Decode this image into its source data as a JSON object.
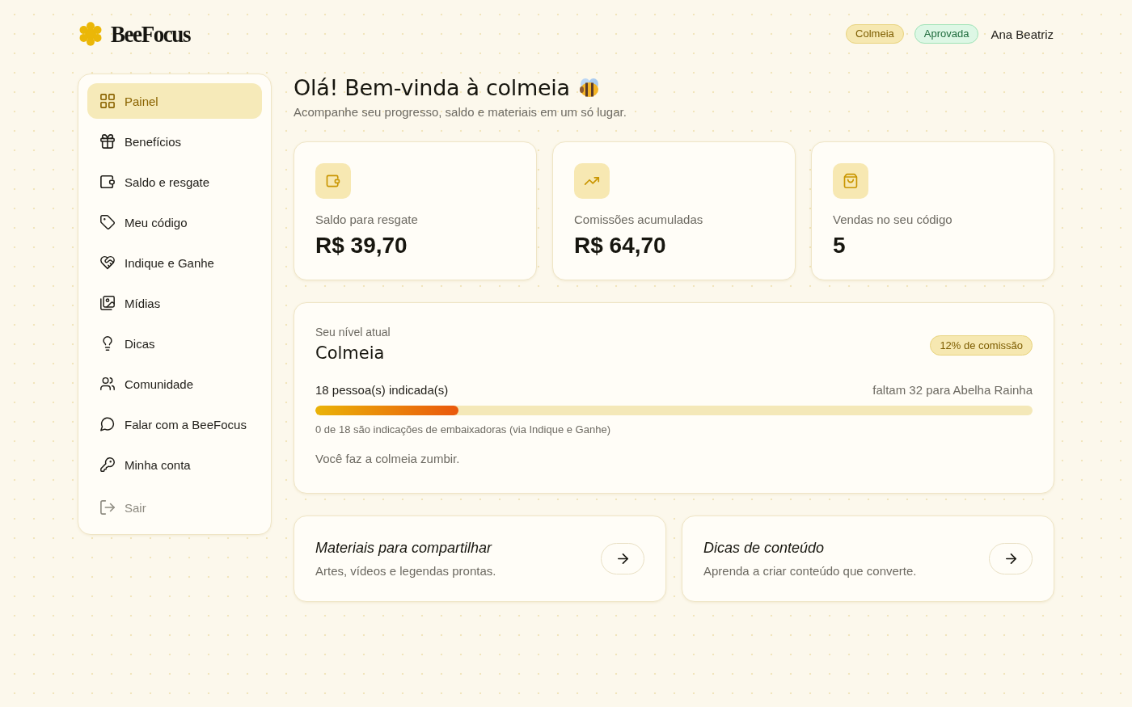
{
  "brand": {
    "name": "BeeFocus"
  },
  "header": {
    "badges": [
      {
        "label": "Colmeia",
        "kind": "level"
      },
      {
        "label": "Aprovada",
        "kind": "status"
      }
    ],
    "user_name": "Ana Beatriz"
  },
  "sidebar": {
    "items": [
      {
        "label": "Painel",
        "selected": true
      },
      {
        "label": "Benefícios",
        "selected": false
      },
      {
        "label": "Saldo e resgate",
        "selected": false
      },
      {
        "label": "Meu código",
        "selected": false
      },
      {
        "label": "Indique e Ganhe",
        "selected": false
      },
      {
        "label": "Mídias",
        "selected": false
      },
      {
        "label": "Dicas",
        "selected": false
      },
      {
        "label": "Comunidade",
        "selected": false
      },
      {
        "label": "Falar com a BeeFocus",
        "selected": false
      },
      {
        "label": "Minha conta",
        "selected": false
      }
    ],
    "logout": {
      "label": "Sair"
    }
  },
  "greeting": {
    "title": "Olá! Bem-vinda à colmeia",
    "subtitle": "Acompanhe seu progresso, saldo e materiais em um só lugar."
  },
  "stats": [
    {
      "label": "Saldo para resgate",
      "value": "R$ 39,70"
    },
    {
      "label": "Comissões acumuladas",
      "value": "R$ 64,70"
    },
    {
      "label": "Vendas no seu código",
      "value": "5"
    }
  ],
  "level_card": {
    "caption": "Seu nível atual",
    "level_name": "Colmeia",
    "commission": "12% de comissão",
    "progress": {
      "label": "18 pessoa(s) indicada(s)",
      "remaining": "faltam 32 para Abelha Rainha",
      "level": 0.2
    },
    "note": "0 de 18 são indicações de embaixadoras (via Indique e Ganhe)",
    "message": "Você faz a colmeia zumbir."
  },
  "shortcuts": [
    {
      "title": "Materiais para compartilhar",
      "description": "Artes, vídeos e legendas prontas."
    },
    {
      "title": "Dicas de conteúdo",
      "description": "Aprenda a criar conteúdo que converte."
    }
  ]
}
